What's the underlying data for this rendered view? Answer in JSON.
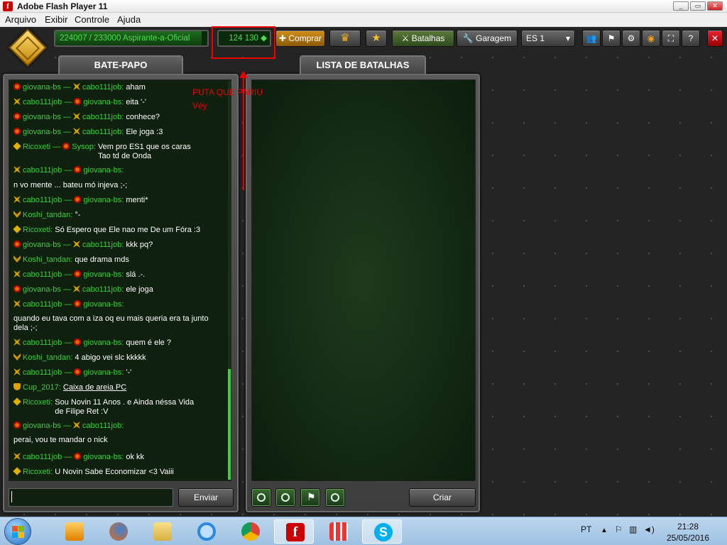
{
  "window": {
    "title": "Adobe Flash Player 11"
  },
  "menu": [
    "Arquivo",
    "Exibir",
    "Controle",
    "Ajuda"
  ],
  "topbar": {
    "xp": "224007 / 233000  Aspirante-a-Oficial",
    "xp_progress": 0.9614,
    "crystals": "124 130",
    "buy_label": "Comprar",
    "battles_label": "Batalhas",
    "garage_label": "Garagem",
    "server": "ES 1"
  },
  "chat": {
    "tab_title": "BATE-PAPO",
    "send_label": "Enviar",
    "messages": [
      {
        "icon1": "gen",
        "from": "giovana-bs",
        "icon2": "star",
        "to": "cabo111job",
        "text": "aham"
      },
      {
        "icon1": "star",
        "from": "cabo111job",
        "icon2": "gen",
        "to": "giovana-bs",
        "text": "eita '-'"
      },
      {
        "icon1": "gen",
        "from": "giovana-bs",
        "icon2": "star",
        "to": "cabo111job",
        "text": "conhece?"
      },
      {
        "icon1": "gen",
        "from": "giovana-bs",
        "icon2": "star",
        "to": "cabo111job",
        "text": "Ele joga :3"
      },
      {
        "icon1": "dia",
        "from": "Ricoxeti",
        "icon2": "gen",
        "to": "Sysop",
        "text": "Vem pro ES1 que os caras Tao td de Onda"
      },
      {
        "icon1": "star",
        "from": "cabo111job",
        "icon2": "gen",
        "to": "giovana-bs",
        "text": ""
      },
      {
        "line": "n vo mente ... bateu mó injeva ;-;"
      },
      {
        "icon1": "star",
        "from": "cabo111job",
        "icon2": "gen",
        "to": "giovana-bs",
        "text": "menti*"
      },
      {
        "icon1": "chev",
        "from": "Koshi_tandan",
        "text": "°-"
      },
      {
        "icon1": "dia",
        "from": "Ricoxeti",
        "text": "Só Espero que Ele nao me De um Fóra :3"
      },
      {
        "icon1": "gen",
        "from": "giovana-bs",
        "icon2": "star",
        "to": "cabo111job",
        "text": "kkk pq?"
      },
      {
        "icon1": "chev",
        "from": "Koshi_tandan",
        "text": "que drama mds"
      },
      {
        "icon1": "star",
        "from": "cabo111job",
        "icon2": "gen",
        "to": "giovana-bs",
        "text": "slá .-."
      },
      {
        "icon1": "gen",
        "from": "giovana-bs",
        "icon2": "star",
        "to": "cabo111job",
        "text": "ele joga"
      },
      {
        "icon1": "star",
        "from": "cabo111job",
        "icon2": "gen",
        "to": "giovana-bs",
        "text": ""
      },
      {
        "line": "quando eu tava com a iza oq eu mais queria era ta junto dela ;-;"
      },
      {
        "icon1": "star",
        "from": "cabo111job",
        "icon2": "gen",
        "to": "giovana-bs",
        "text": "quem é ele ?"
      },
      {
        "icon1": "chev",
        "from": "Koshi_tandan",
        "text": "4 abigo vei slc kkkkk"
      },
      {
        "icon1": "star",
        "from": "cabo111job",
        "icon2": "gen",
        "to": "giovana-bs",
        "text": "'-'"
      },
      {
        "icon1": "cup",
        "from": "Cup_2017",
        "text": "Caixa de areia PC",
        "link": true
      },
      {
        "icon1": "dia",
        "from": "Ricoxeti",
        "text": "Sou Novin 11 Anos . e Ainda néssa Vida de Filipe Ret :V"
      },
      {
        "icon1": "gen",
        "from": "giovana-bs",
        "icon2": "star",
        "to": "cabo111job",
        "text": ""
      },
      {
        "line": "perai, vou te mandar o nick"
      },
      {
        "icon1": "star",
        "from": "cabo111job",
        "icon2": "gen",
        "to": "giovana-bs",
        "text": "ok kk"
      },
      {
        "icon1": "dia",
        "from": "Ricoxeti",
        "text": "U Novin Sabe Economizar <3 Vaiii"
      }
    ]
  },
  "battles": {
    "tab_title": "LISTA DE BATALHAS",
    "create_label": "Criar"
  },
  "annotation": {
    "line1": "PUTA QUE PARIU",
    "line2": "Véy"
  },
  "taskbar": {
    "lang": "PT",
    "time": "21:28",
    "date": "25/05/2016"
  }
}
